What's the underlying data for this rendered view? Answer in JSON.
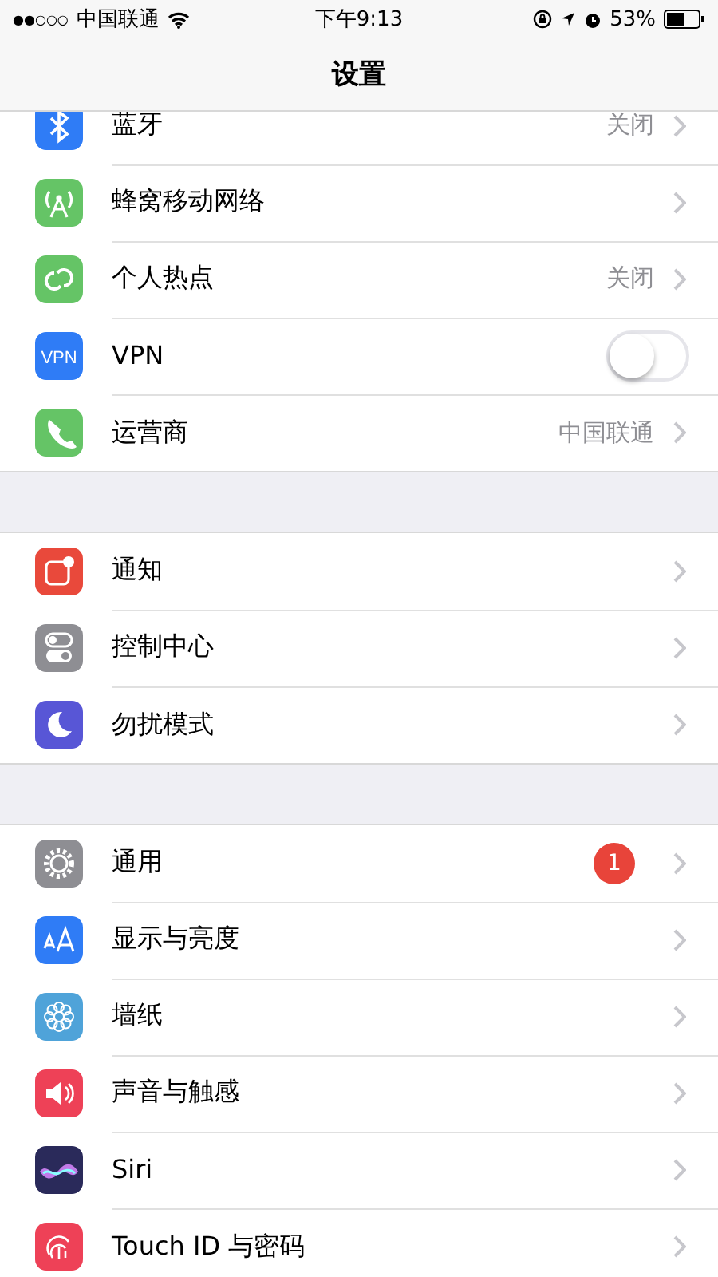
{
  "status_bar": {
    "signal": "●●○○○",
    "carrier": "中国联通",
    "time": "下午9:13",
    "battery": "53%"
  },
  "nav_bar": {
    "title": "设置"
  },
  "sections": [
    {
      "rows": [
        {
          "kind": "link",
          "label": "蓝牙",
          "value": "关闭"
        },
        {
          "kind": "link",
          "label": "蜂窝移动网络"
        },
        {
          "kind": "link",
          "label": "个人热点",
          "value": "关闭"
        },
        {
          "kind": "toggle",
          "icon_text": "VPN",
          "label": "VPN",
          "on": false
        },
        {
          "kind": "link",
          "label": "运营商",
          "value": "中国联通"
        }
      ]
    },
    {
      "rows": [
        {
          "kind": "link",
          "label": "通知"
        },
        {
          "kind": "link",
          "label": "控制中心"
        },
        {
          "kind": "link",
          "label": "勿扰模式"
        }
      ]
    },
    {
      "rows": [
        {
          "kind": "link",
          "label": "通用",
          "badge": "1"
        },
        {
          "kind": "link",
          "label": "显示与亮度"
        },
        {
          "kind": "link",
          "label": "墙纸"
        },
        {
          "kind": "link",
          "label": "声音与触感"
        },
        {
          "kind": "link",
          "label": "Siri"
        },
        {
          "kind": "link",
          "label": "Touch ID 与密码"
        }
      ]
    }
  ]
}
